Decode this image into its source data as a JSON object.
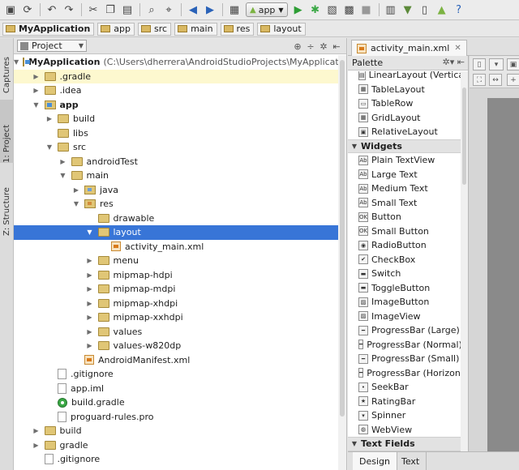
{
  "colors": {
    "selection": "#3875d7",
    "current_line": "#fdf8cf",
    "folder": "#e0c676",
    "run": "#2e9e35",
    "debug": "#3aa845"
  },
  "toolbar": {
    "icons": [
      "save-all-icon",
      "synchronize-icon",
      "undo-icon",
      "redo-icon",
      "cut-icon",
      "copy-icon",
      "paste-icon",
      "find-icon",
      "replace-icon",
      "back-icon",
      "forward-icon",
      "make-project-icon",
      "run-config-icon",
      "run-icon",
      "debug-icon",
      "coverage-icon",
      "attach-debugger-icon",
      "stop-icon",
      "project-structure-icon",
      "sdk-manager-icon",
      "avd-manager-icon",
      "android-monitor-icon",
      "help-icon"
    ],
    "run_config": "app"
  },
  "breadcrumb": [
    "MyApplication",
    "app",
    "src",
    "main",
    "res",
    "layout"
  ],
  "side_tabs": [
    "Captures",
    "1: Project",
    "Z: Structure"
  ],
  "project_panel": {
    "view_mode": "Project",
    "rows": [
      {
        "label": "MyApplication",
        "path": "(C:\\Users\\dherrera\\AndroidStudioProjects\\MyApplication)",
        "depth": 0,
        "arrow": "▼",
        "icon": "module",
        "bold": true
      },
      {
        "label": ".gradle",
        "depth": 1,
        "arrow": "▶",
        "icon": "folder",
        "current": true
      },
      {
        "label": ".idea",
        "depth": 1,
        "arrow": "▶",
        "icon": "folder"
      },
      {
        "label": "app",
        "depth": 1,
        "arrow": "▼",
        "icon": "module",
        "bold": true
      },
      {
        "label": "build",
        "depth": 2,
        "arrow": "▶",
        "icon": "folder"
      },
      {
        "label": "libs",
        "depth": 2,
        "arrow": "",
        "icon": "folder"
      },
      {
        "label": "src",
        "depth": 2,
        "arrow": "▼",
        "icon": "folder"
      },
      {
        "label": "androidTest",
        "depth": 3,
        "arrow": "▶",
        "icon": "folder"
      },
      {
        "label": "main",
        "depth": 3,
        "arrow": "▼",
        "icon": "folder"
      },
      {
        "label": "java",
        "depth": 4,
        "arrow": "▶",
        "icon": "folder-src"
      },
      {
        "label": "res",
        "depth": 4,
        "arrow": "▼",
        "icon": "folder-res"
      },
      {
        "label": "drawable",
        "depth": 5,
        "arrow": "",
        "icon": "folder"
      },
      {
        "label": "layout",
        "depth": 5,
        "arrow": "▼",
        "icon": "folder",
        "selected": true
      },
      {
        "label": "activity_main.xml",
        "depth": 6,
        "arrow": "",
        "icon": "xml"
      },
      {
        "label": "menu",
        "depth": 5,
        "arrow": "▶",
        "icon": "folder"
      },
      {
        "label": "mipmap-hdpi",
        "depth": 5,
        "arrow": "▶",
        "icon": "folder"
      },
      {
        "label": "mipmap-mdpi",
        "depth": 5,
        "arrow": "▶",
        "icon": "folder"
      },
      {
        "label": "mipmap-xhdpi",
        "depth": 5,
        "arrow": "▶",
        "icon": "folder"
      },
      {
        "label": "mipmap-xxhdpi",
        "depth": 5,
        "arrow": "▶",
        "icon": "folder"
      },
      {
        "label": "values",
        "depth": 5,
        "arrow": "▶",
        "icon": "folder"
      },
      {
        "label": "values-w820dp",
        "depth": 5,
        "arrow": "▶",
        "icon": "folder"
      },
      {
        "label": "AndroidManifest.xml",
        "depth": 4,
        "arrow": "",
        "icon": "xml"
      },
      {
        "label": ".gitignore",
        "depth": 2,
        "arrow": "",
        "icon": "file"
      },
      {
        "label": "app.iml",
        "depth": 2,
        "arrow": "",
        "icon": "file"
      },
      {
        "label": "build.gradle",
        "depth": 2,
        "arrow": "",
        "icon": "gradle"
      },
      {
        "label": "proguard-rules.pro",
        "depth": 2,
        "arrow": "",
        "icon": "file"
      },
      {
        "label": "build",
        "depth": 1,
        "arrow": "▶",
        "icon": "folder"
      },
      {
        "label": "gradle",
        "depth": 1,
        "arrow": "▶",
        "icon": "folder"
      },
      {
        "label": ".gitignore",
        "depth": 1,
        "arrow": "",
        "icon": "file"
      }
    ]
  },
  "editor": {
    "tab": "activity_main.xml",
    "palette_title": "Palette",
    "palette": [
      {
        "label": "LinearLayout (Vertical)",
        "icon": "layout-icon",
        "glyph": "▤"
      },
      {
        "label": "TableLayout",
        "icon": "layout-icon",
        "glyph": "▦"
      },
      {
        "label": "TableRow",
        "icon": "layout-icon",
        "glyph": "▭"
      },
      {
        "label": "GridLayout",
        "icon": "layout-icon",
        "glyph": "▦"
      },
      {
        "label": "RelativeLayout",
        "icon": "layout-icon",
        "glyph": "▣"
      },
      {
        "label": "Widgets",
        "category": true
      },
      {
        "label": "Plain TextView",
        "icon": "text-icon",
        "glyph": "Ab"
      },
      {
        "label": "Large Text",
        "icon": "text-icon",
        "glyph": "Ab"
      },
      {
        "label": "Medium Text",
        "icon": "text-icon",
        "glyph": "Ab"
      },
      {
        "label": "Small Text",
        "icon": "text-icon",
        "glyph": "Ab"
      },
      {
        "label": "Button",
        "icon": "button-icon",
        "glyph": "OK"
      },
      {
        "label": "Small Button",
        "icon": "button-icon",
        "glyph": "OK"
      },
      {
        "label": "RadioButton",
        "icon": "radio-icon",
        "glyph": "◉"
      },
      {
        "label": "CheckBox",
        "icon": "checkbox-icon",
        "glyph": "✔"
      },
      {
        "label": "Switch",
        "icon": "switch-icon",
        "glyph": "▬"
      },
      {
        "label": "ToggleButton",
        "icon": "toggle-icon",
        "glyph": "▬"
      },
      {
        "label": "ImageButton",
        "icon": "image-icon",
        "glyph": "▨"
      },
      {
        "label": "ImageView",
        "icon": "image-icon",
        "glyph": "▨"
      },
      {
        "label": "ProgressBar (Large)",
        "icon": "progress-icon",
        "glyph": "━"
      },
      {
        "label": "ProgressBar (Normal)",
        "icon": "progress-icon",
        "glyph": "━"
      },
      {
        "label": "ProgressBar (Small)",
        "icon": "progress-icon",
        "glyph": "━"
      },
      {
        "label": "ProgressBar (Horizontal)",
        "icon": "progress-icon",
        "glyph": "━"
      },
      {
        "label": "SeekBar",
        "icon": "seekbar-icon",
        "glyph": "•"
      },
      {
        "label": "RatingBar",
        "icon": "star-icon",
        "glyph": "★"
      },
      {
        "label": "Spinner",
        "icon": "spinner-icon",
        "glyph": "▾"
      },
      {
        "label": "WebView",
        "icon": "globe-icon",
        "glyph": "◍"
      },
      {
        "label": "Text Fields",
        "category": true
      }
    ],
    "bottom_tabs": [
      "Design",
      "Text"
    ]
  }
}
